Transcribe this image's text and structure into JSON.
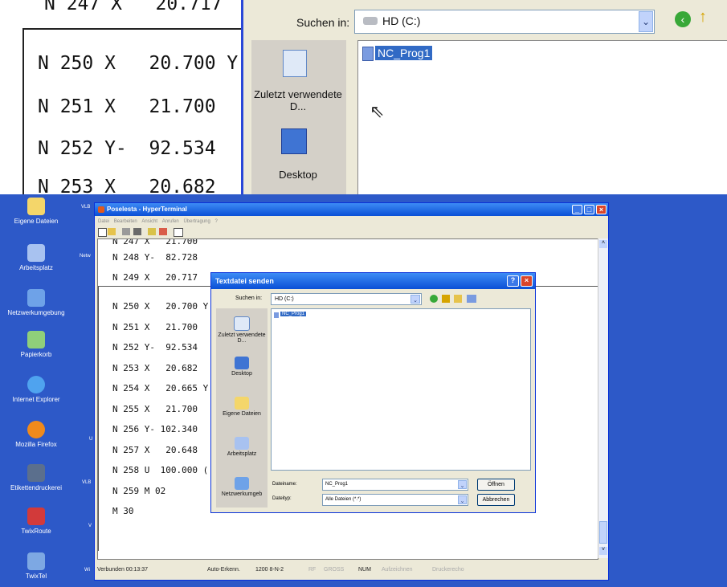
{
  "zoom": {
    "lines": [
      "N 247 X   20.717",
      "N 250 X   20.700 Y",
      "N 251 X   21.700",
      "N 252 Y-  92.534",
      "N 253 X   20.682"
    ],
    "search_in_label": "Suchen in:",
    "drive": "HD (C:)",
    "places": {
      "recent": "Zuletzt verwendete D...",
      "desktop": "Desktop"
    },
    "file": "NC_Prog1"
  },
  "desktop": {
    "icons": [
      "Eigene Dateien",
      "Arbeitsplatz",
      "Netzwerkumgebung",
      "Papierkorb",
      "Internet Explorer",
      "Mozilla Firefox",
      "Etikettendruckerei",
      "TwixRoute",
      "TwixTel"
    ],
    "side_labels": [
      "VLB",
      "Netw",
      "",
      "",
      "",
      "U",
      "VLB",
      "V",
      "Wi"
    ]
  },
  "hyperterminal": {
    "title": "Poselesta - HyperTerminal",
    "menu": [
      "Datei",
      "Bearbeiten",
      "Ansicht",
      "Anrufen",
      "Übertragung",
      "?"
    ],
    "lines_top": [
      "N 247 X   21.700",
      "N 248 Y-  82.728",
      "N 249 X   20.717"
    ],
    "lines": [
      "N 250 X   20.700 Y",
      "N 251 X   21.700",
      "N 252 Y-  92.534",
      "N 253 X   20.682",
      "N 254 X   20.665 Y",
      "N 255 X   21.700",
      "N 256 Y- 102.340",
      "N 257 X   20.648",
      "N 258 U  100.000 (",
      "N 259 M 02",
      "M 30"
    ],
    "status": [
      "Verbunden 00:13:37",
      "Auto-Erkenn.",
      "1200 8-N-2",
      "RF",
      "GROSS",
      "NUM",
      "Aufzeichnen",
      "Druckerecho"
    ]
  },
  "dialog": {
    "title": "Textdatei senden",
    "search_in_label": "Suchen in:",
    "drive": "HD (C:)",
    "places": [
      "Zuletzt verwendete D...",
      "Desktop",
      "Eigene Dateien",
      "Arbeitsplatz",
      "Netzwerkumgeb"
    ],
    "file": "NC_Prog1",
    "filename_label": "Dateiname:",
    "filename_value": "NC_Prog1",
    "filetype_label": "Dateityp:",
    "filetype_value": "Alle Dateien (*.*)",
    "open_button": "Öffnen",
    "cancel_button": "Abbrechen"
  }
}
